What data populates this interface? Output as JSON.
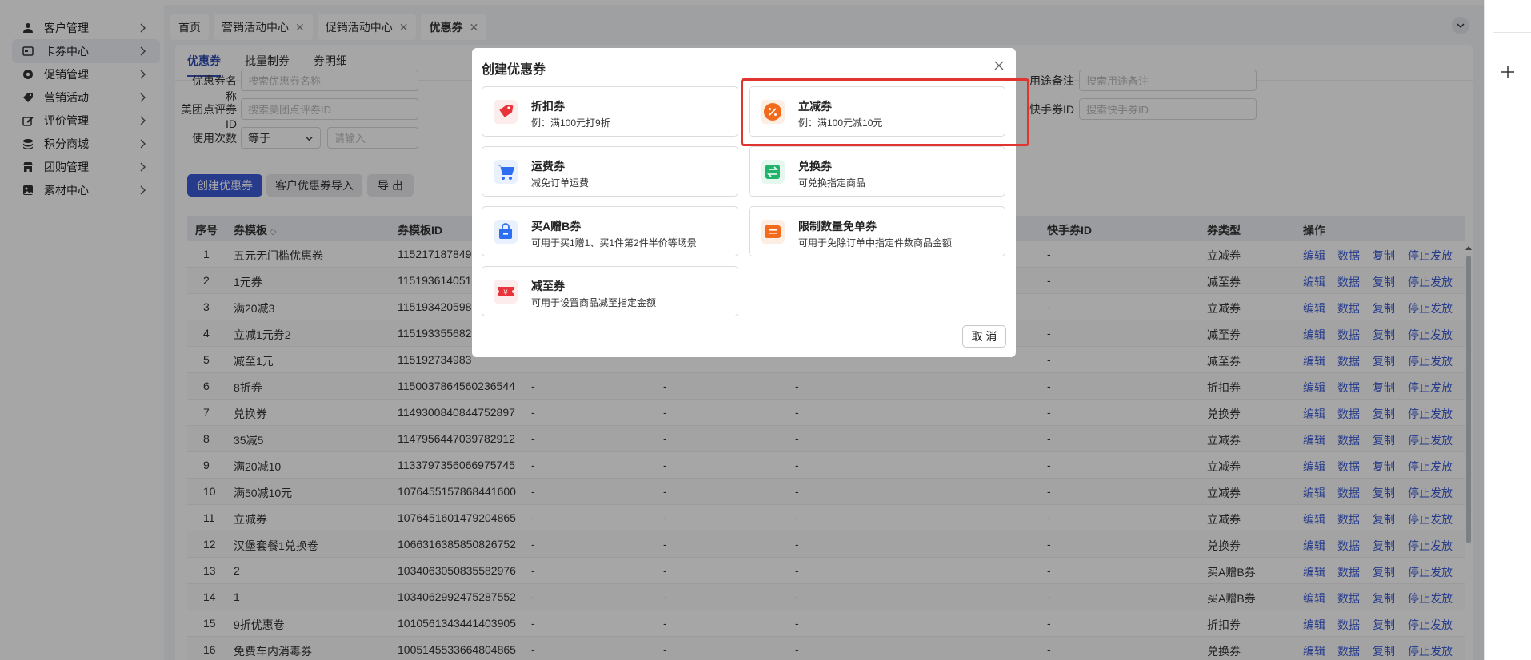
{
  "sidebar": {
    "items": [
      {
        "label": "客户管理",
        "icon": "user-icon"
      },
      {
        "label": "卡券中心",
        "icon": "card-icon"
      },
      {
        "label": "促销管理",
        "icon": "gear-icon"
      },
      {
        "label": "营销活动",
        "icon": "tag-icon"
      },
      {
        "label": "评价管理",
        "icon": "edit-icon"
      },
      {
        "label": "积分商城",
        "icon": "coins-icon"
      },
      {
        "label": "团购管理",
        "icon": "store-icon"
      },
      {
        "label": "素材中心",
        "icon": "image-icon"
      }
    ],
    "active_index": 1
  },
  "tabs": [
    {
      "label": "首页",
      "closable": false
    },
    {
      "label": "营销活动中心",
      "closable": true
    },
    {
      "label": "促销活动中心",
      "closable": true
    },
    {
      "label": "优惠券",
      "closable": true
    }
  ],
  "subtabs": [
    "优惠券",
    "批量制券",
    "券明细"
  ],
  "filters": {
    "name_label": "优惠券名称",
    "name_placeholder": "搜索优惠券名称",
    "meituan_label": "美团点评券ID",
    "meituan_placeholder": "搜索美团点评券ID",
    "usage_label": "使用次数",
    "usage_select": "等于",
    "usage_placeholder": "请输入",
    "purpose_label": "用途备注",
    "purpose_placeholder": "搜索用途备注",
    "kuaishou_label": "快手券ID",
    "kuaishou_placeholder": "搜索快手券ID"
  },
  "actions": {
    "create": "创建优惠券",
    "import": "客户优惠券导入",
    "export": "导 出"
  },
  "table": {
    "headers": {
      "index": "序号",
      "template": "券模板",
      "template_id": "券模板ID",
      "kuaishou_id": "快手券ID",
      "type": "券类型",
      "ops": "操作"
    },
    "ops": [
      "编辑",
      "数据",
      "复制",
      "停止发放"
    ],
    "rows": [
      {
        "index": "1",
        "name": "五元无门槛优惠卷",
        "id": "115217187849",
        "c1": "",
        "c2": "",
        "c3": "",
        "ks": "-",
        "type": "立减券"
      },
      {
        "index": "2",
        "name": "1元券",
        "id": "115193614051",
        "c1": "",
        "c2": "",
        "c3": "",
        "ks": "-",
        "type": "减至券"
      },
      {
        "index": "3",
        "name": "满20减3",
        "id": "115193420598",
        "c1": "",
        "c2": "",
        "c3": "",
        "ks": "-",
        "type": "立减券"
      },
      {
        "index": "4",
        "name": "立减1元券2",
        "id": "115193355682",
        "c1": "",
        "c2": "",
        "c3": "",
        "ks": "-",
        "type": "减至券"
      },
      {
        "index": "5",
        "name": "减至1元",
        "id": "115192734983",
        "c1": "",
        "c2": "",
        "c3": "",
        "ks": "-",
        "type": "减至券"
      },
      {
        "index": "6",
        "name": "8折券",
        "id": "1150037864560236544",
        "c1": "-",
        "c2": "-",
        "c3": "-",
        "ks": "-",
        "type": "折扣券"
      },
      {
        "index": "7",
        "name": "兑换券",
        "id": "1149300840844752897",
        "c1": "-",
        "c2": "-",
        "c3": "-",
        "ks": "-",
        "type": "兑换券"
      },
      {
        "index": "8",
        "name": "35减5",
        "id": "1147956447039782912",
        "c1": "-",
        "c2": "-",
        "c3": "-",
        "ks": "-",
        "type": "立减券"
      },
      {
        "index": "9",
        "name": "满20减10",
        "id": "1133797356066975745",
        "c1": "-",
        "c2": "-",
        "c3": "-",
        "ks": "-",
        "type": "立减券"
      },
      {
        "index": "10",
        "name": "满50减10元",
        "id": "1076455157868441600",
        "c1": "-",
        "c2": "-",
        "c3": "-",
        "ks": "-",
        "type": "立减券"
      },
      {
        "index": "11",
        "name": "立减券",
        "id": "1076451601479204865",
        "c1": "-",
        "c2": "-",
        "c3": "-",
        "ks": "-",
        "type": "立减券"
      },
      {
        "index": "12",
        "name": "汉堡套餐1兑换卷",
        "id": "1066316385850826752",
        "c1": "-",
        "c2": "-",
        "c3": "-",
        "ks": "-",
        "type": "兑换券"
      },
      {
        "index": "13",
        "name": "2",
        "id": "1034063050835582976",
        "c1": "-",
        "c2": "-",
        "c3": "-",
        "ks": "-",
        "type": "买A赠B券"
      },
      {
        "index": "14",
        "name": "1",
        "id": "1034062992475287552",
        "c1": "-",
        "c2": "-",
        "c3": "-",
        "ks": "-",
        "type": "买A赠B券"
      },
      {
        "index": "15",
        "name": "9折优惠卷",
        "id": "1010561343441403905",
        "c1": "-",
        "c2": "-",
        "c3": "-",
        "ks": "-",
        "type": "折扣券"
      },
      {
        "index": "16",
        "name": "免费车内消毒券",
        "id": "1005145533664804865",
        "c1": "-",
        "c2": "-",
        "c3": "-",
        "ks": "-",
        "type": "兑换券"
      }
    ]
  },
  "modal": {
    "title": "创建优惠券",
    "cancel": "取 消",
    "options": [
      {
        "title": "折扣券",
        "desc": "例：满100元打9折",
        "icon": "discount-tag-icon",
        "color": "#e8333a",
        "bg": "#fdecec"
      },
      {
        "title": "立减券",
        "desc": "例：满100元减10元",
        "icon": "percent-icon",
        "color": "#f26b1d",
        "bg": "#fdeee4"
      },
      {
        "title": "运费券",
        "desc": "减免订单运费",
        "icon": "cart-icon",
        "color": "#2d6ff0",
        "bg": "#eaf1fe"
      },
      {
        "title": "兑换券",
        "desc": "可兑换指定商品",
        "icon": "exchange-icon",
        "color": "#1fb36b",
        "bg": "#e6f7ee"
      },
      {
        "title": "买A赠B券",
        "desc": "可用于买1赠1、买1件第2件半价等场景",
        "icon": "bag-icon",
        "color": "#2d6ff0",
        "bg": "#eaf1fe"
      },
      {
        "title": "限制数量免单券",
        "desc": "可用于免除订单中指定件数商品金额",
        "icon": "ticket-icon",
        "color": "#f26b1d",
        "bg": "#fdeee4"
      },
      {
        "title": "减至券",
        "desc": "可用于设置商品减至指定金额",
        "icon": "yen-ticket-icon",
        "color": "#e8333a",
        "bg": "#fdecec"
      }
    ],
    "selected_index": 1
  },
  "colors": {
    "accent": "#3b5bd6",
    "highlight": "#e0342f"
  }
}
